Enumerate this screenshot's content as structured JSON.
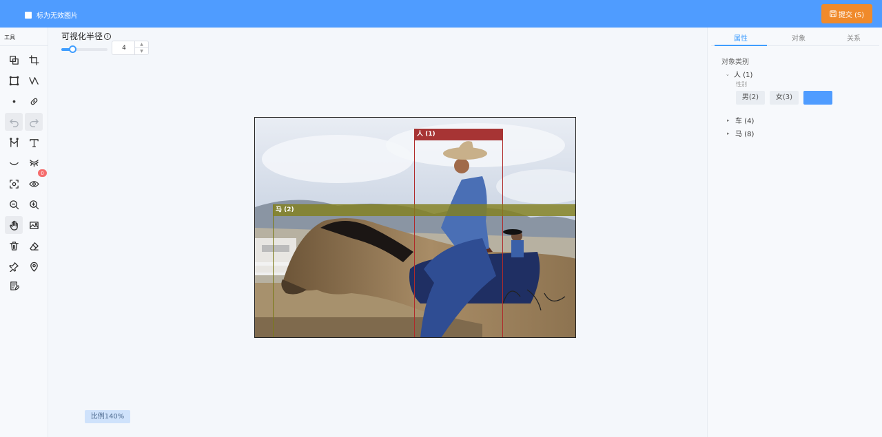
{
  "topbar": {
    "invalid_label": "标为无效图片",
    "submit_label": "提交 (S)",
    "submit_icon": "save-icon"
  },
  "toolbar": {
    "title": "工具",
    "tools": [
      {
        "icon": "copy-shapes-icon"
      },
      {
        "icon": "crop-icon"
      },
      {
        "icon": "rectangle-icon"
      },
      {
        "icon": "polyline-icon"
      },
      {
        "icon": "point-icon"
      },
      {
        "icon": "link-icon"
      },
      {
        "icon": "undo-icon"
      },
      {
        "icon": "redo-icon"
      },
      {
        "icon": "keypoint-icon"
      },
      {
        "icon": "text-icon"
      },
      {
        "icon": "eye-closed-icon"
      },
      {
        "icon": "eyelashes-icon"
      },
      {
        "icon": "focus-icon"
      },
      {
        "icon": "eye-icon"
      },
      {
        "icon": "zoom-out-icon"
      },
      {
        "icon": "zoom-in-icon"
      },
      {
        "icon": "hand-icon"
      },
      {
        "icon": "image-icon"
      },
      {
        "icon": "trash-icon"
      },
      {
        "icon": "eraser-icon"
      },
      {
        "icon": "pin-icon"
      },
      {
        "icon": "location-icon"
      },
      {
        "icon": "notes-icon"
      }
    ],
    "eye_badge": "0"
  },
  "visual_radius": {
    "label": "可视化半径",
    "value": "4",
    "slider_level": 0.25
  },
  "annotations": [
    {
      "label": "人 (1)",
      "color": "#b02a2a"
    },
    {
      "label": "马 (2)",
      "color": "#7b7a17"
    }
  ],
  "zoom": {
    "label": "比例140%"
  },
  "panel": {
    "tabs": [
      "属性",
      "对象",
      "关系"
    ],
    "active_tab": "属性",
    "section_title": "对象类别",
    "categories": [
      {
        "label": "人 (1)",
        "expanded": true
      },
      {
        "label": "车 (4)",
        "expanded": false
      },
      {
        "label": "马 (8)",
        "expanded": false
      }
    ],
    "attribute_label": "性别",
    "options": [
      "男(2)",
      "女(3)",
      ""
    ]
  },
  "colors": {
    "topbar": "#4f9cff",
    "submit": "#f08a2b",
    "accent": "#409eff"
  }
}
